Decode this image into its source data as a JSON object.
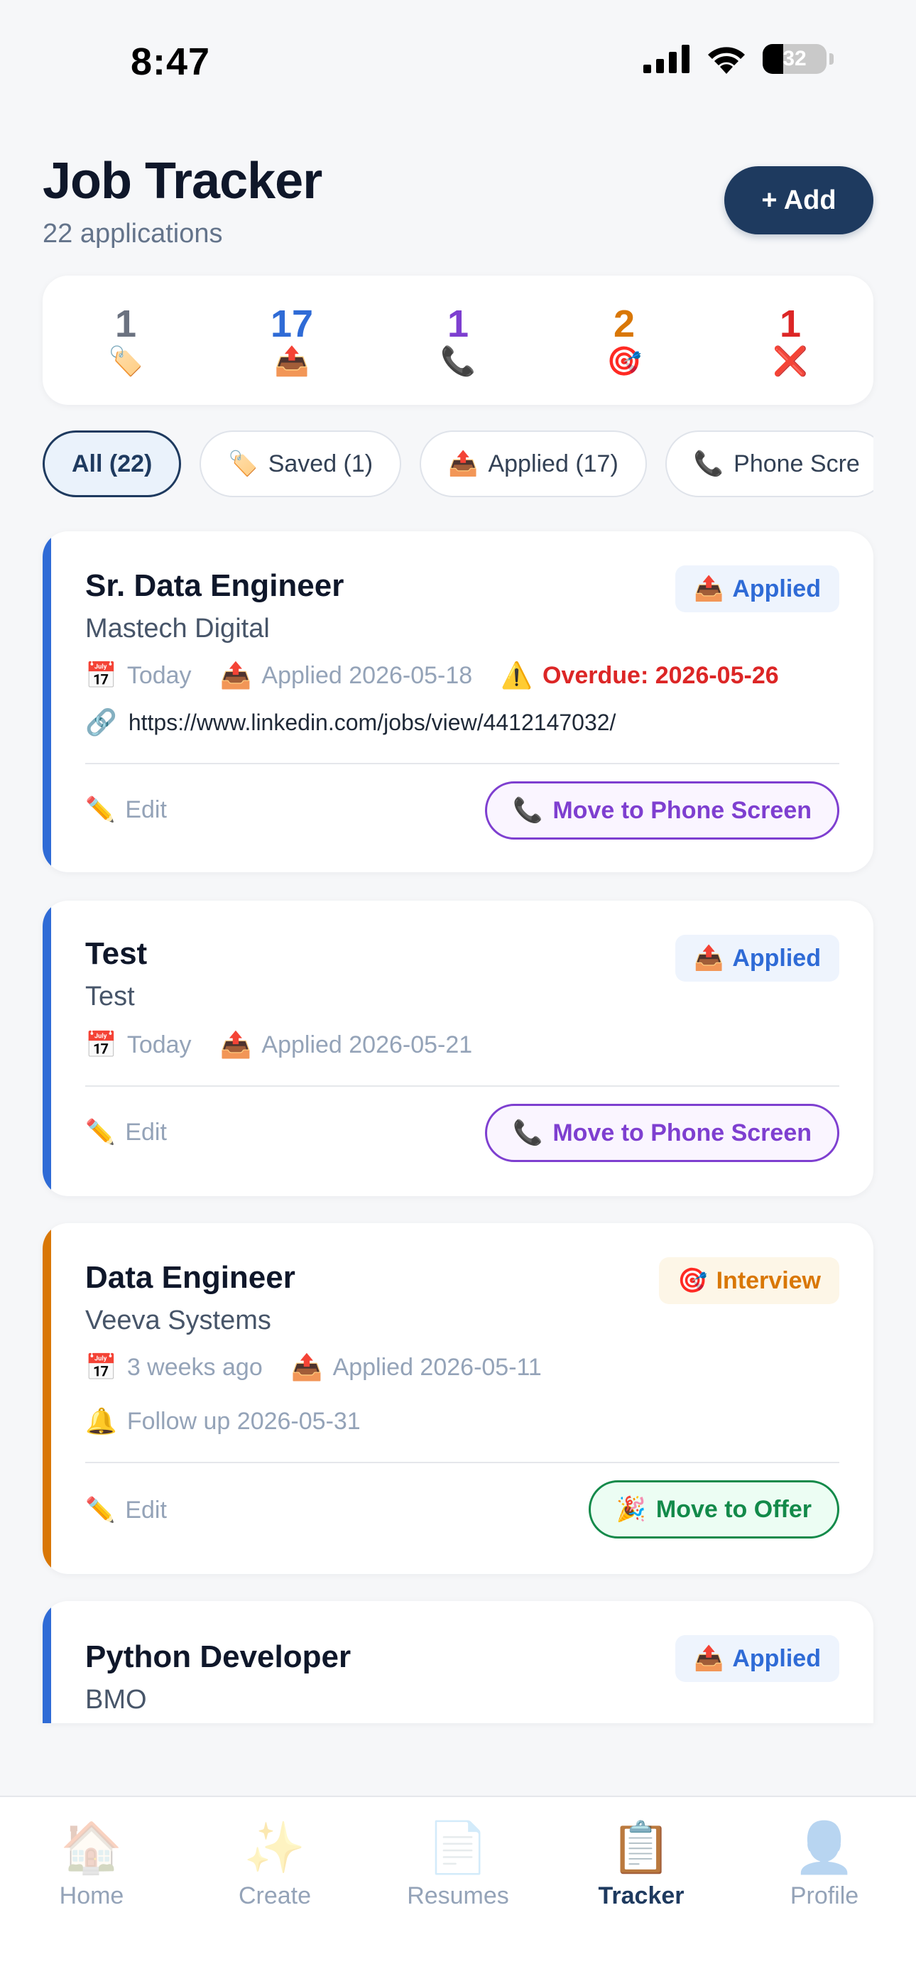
{
  "status_bar": {
    "time": "8:47",
    "battery": "32",
    "battery_level": 0.32
  },
  "header": {
    "title": "Job Tracker",
    "subtitle": "22 applications",
    "add_label": "+ Add"
  },
  "stats": [
    {
      "count": "1",
      "icon": "🏷️",
      "icon_name": "tag-icon",
      "color": "#6b7280"
    },
    {
      "count": "17",
      "icon": "📤",
      "icon_name": "outbox-icon",
      "color": "#2f6bd6"
    },
    {
      "count": "1",
      "icon": "📞",
      "icon_name": "phone-icon",
      "color": "#7e3fd0"
    },
    {
      "count": "2",
      "icon": "🎯",
      "icon_name": "target-icon",
      "color": "#d97706"
    },
    {
      "count": "1",
      "icon": "❌",
      "icon_name": "cross-icon",
      "color": "#dc2626"
    }
  ],
  "filters": [
    {
      "icon": "",
      "label": "All (22)",
      "active": true
    },
    {
      "icon": "🏷️",
      "icon_name": "tag-icon",
      "label": "Saved (1)"
    },
    {
      "icon": "📤",
      "icon_name": "outbox-icon",
      "label": "Applied (17)"
    },
    {
      "icon": "📞",
      "icon_name": "phone-icon",
      "label": "Phone Scre"
    }
  ],
  "cards": [
    {
      "title": "Sr. Data Engineer",
      "company": "Mastech Digital",
      "status": "Applied",
      "status_icon": "📤",
      "accent": "#2f6bd6",
      "meta": [
        {
          "icon": "📅",
          "icon_name": "calendar-icon",
          "text": "Today"
        },
        {
          "icon": "📤",
          "icon_name": "outbox-icon",
          "text": "Applied 2026-05-18"
        },
        {
          "icon": "⚠️",
          "icon_name": "warning-icon",
          "text": "Overdue: 2026-05-26",
          "overdue": true
        }
      ],
      "link_icon": "🔗",
      "link": "https://www.linkedin.com/jobs/view/4412147032/",
      "edit_icon": "✏️",
      "edit_label": "Edit",
      "action_icon": "📞",
      "action_label": "Move to Phone Screen"
    },
    {
      "title": "Test",
      "company": "Test",
      "status": "Applied",
      "status_icon": "📤",
      "accent": "#2f6bd6",
      "meta": [
        {
          "icon": "📅",
          "icon_name": "calendar-icon",
          "text": "Today"
        },
        {
          "icon": "📤",
          "icon_name": "outbox-icon",
          "text": "Applied 2026-05-21"
        }
      ],
      "edit_icon": "✏️",
      "edit_label": "Edit",
      "action_icon": "📞",
      "action_label": "Move to Phone Screen"
    },
    {
      "title": "Data Engineer",
      "company": "Veeva Systems",
      "status": "Interview",
      "status_icon": "🎯",
      "accent": "#d97706",
      "meta": [
        {
          "icon": "📅",
          "icon_name": "calendar-icon",
          "text": "3 weeks ago"
        },
        {
          "icon": "📤",
          "icon_name": "outbox-icon",
          "text": "Applied 2026-05-11"
        }
      ],
      "followup_icon": "🔔",
      "followup": "Follow up 2026-05-31",
      "edit_icon": "✏️",
      "edit_label": "Edit",
      "action_icon": "🎉",
      "action_label": "Move to Offer"
    },
    {
      "title": "Python Developer",
      "company": "BMO",
      "status": "Applied",
      "status_icon": "📤",
      "accent": "#2f6bd6"
    }
  ],
  "tabs": [
    {
      "icon": "🏠",
      "icon_name": "home-icon",
      "label": "Home"
    },
    {
      "icon": "✨",
      "icon_name": "sparkles-icon",
      "label": "Create"
    },
    {
      "icon": "📄",
      "icon_name": "document-icon",
      "label": "Resumes"
    },
    {
      "icon": "📋",
      "icon_name": "clipboard-icon",
      "label": "Tracker",
      "active": true
    },
    {
      "icon": "👤",
      "icon_name": "person-icon",
      "label": "Profile"
    }
  ]
}
